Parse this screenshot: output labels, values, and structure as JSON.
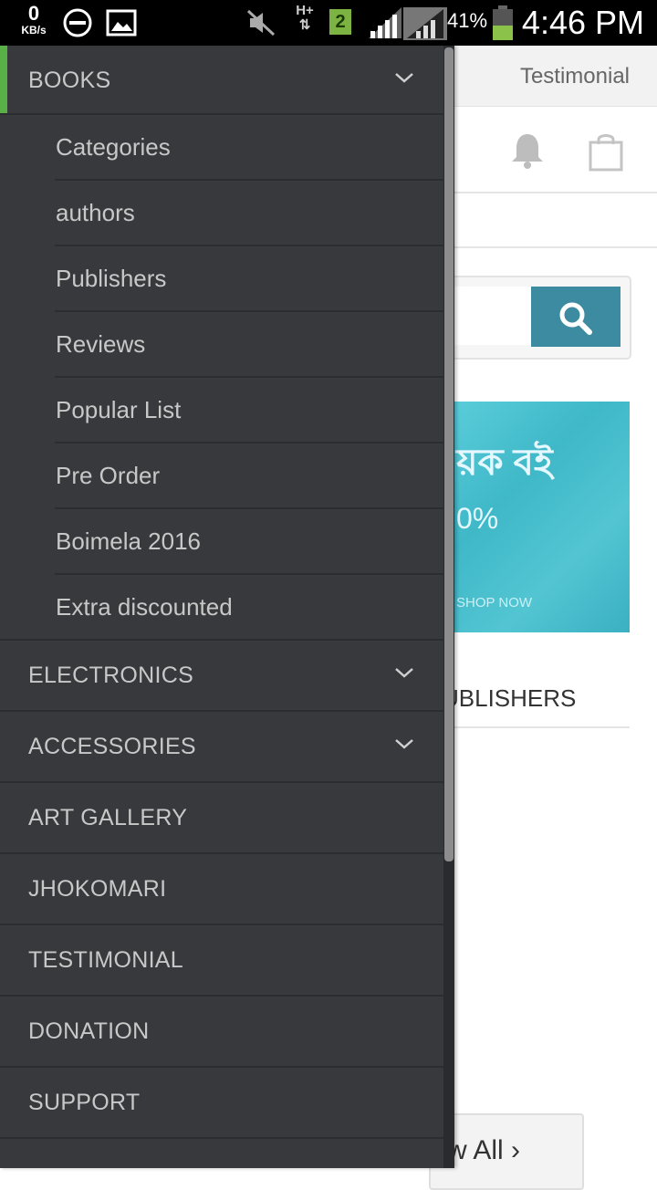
{
  "status_bar": {
    "speed_value": "0",
    "speed_unit": "KB/s",
    "network_type": "H+",
    "sim_number": "2",
    "battery_percent": "41%",
    "time": "4:46 PM"
  },
  "background": {
    "top_link": "Testimonial",
    "banner_line1": "য়ক বই",
    "banner_line2": "0%",
    "banner_cta": "SHOP NOW",
    "publishers_tab": "UBLISHERS",
    "view_all": "w All ›"
  },
  "drawer": {
    "books": {
      "label": "BOOKS",
      "sub_items": [
        "Categories",
        "authors",
        "Publishers",
        "Reviews",
        "Popular List",
        "Pre Order",
        "Boimela 2016",
        "Extra discounted"
      ]
    },
    "items": [
      "ELECTRONICS",
      "ACCESSORIES",
      "ART GALLERY",
      "JHOKOMARI",
      "TESTIMONIAL",
      "DONATION",
      "SUPPORT"
    ]
  },
  "colors": {
    "drawer_bg": "#38393d",
    "accent_green": "#58b047",
    "search_button": "#3c8ba0",
    "text_light": "#c8c8c8"
  }
}
